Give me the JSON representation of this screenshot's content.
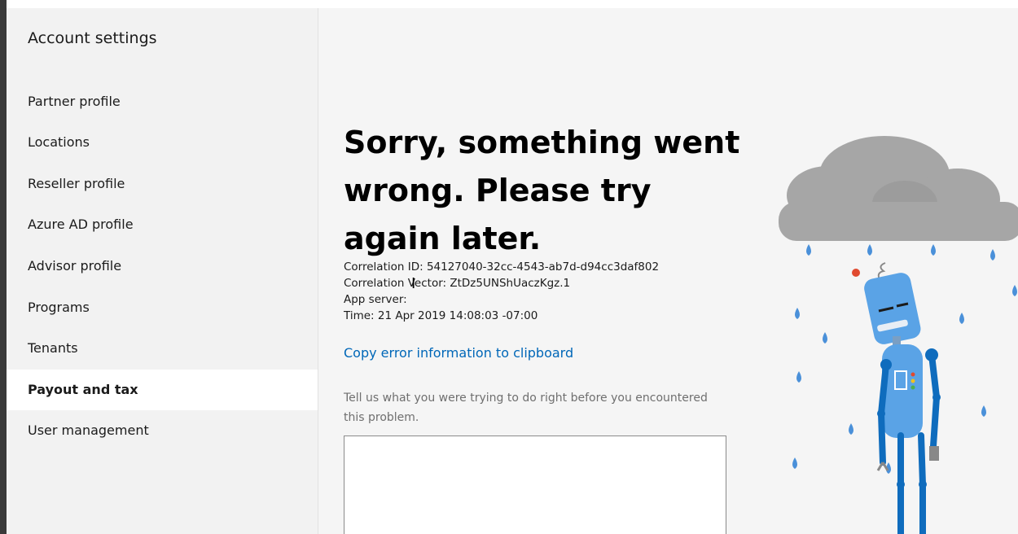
{
  "sidebar": {
    "title": "Account settings",
    "items": [
      {
        "label": "Partner profile",
        "selected": false
      },
      {
        "label": "Locations",
        "selected": false
      },
      {
        "label": "Reseller profile",
        "selected": false
      },
      {
        "label": "Azure AD profile",
        "selected": false
      },
      {
        "label": "Advisor profile",
        "selected": false
      },
      {
        "label": "Programs",
        "selected": false
      },
      {
        "label": "Tenants",
        "selected": false
      },
      {
        "label": "Payout and tax",
        "selected": true
      },
      {
        "label": "User management",
        "selected": false
      }
    ]
  },
  "error": {
    "heading": "Sorry, something went wrong. Please try again later.",
    "correlation_id": "Correlation ID: 54127040-32cc-4543-ab7d-d94cc3daf802",
    "correlation_vector": "Correlation Vector: ZtDz5UNShUaczKgz.1",
    "app_server": "App server:",
    "time": "Time: 21 Apr 2019 14:08:03 -07:00",
    "copy_link": "Copy error information to clipboard",
    "feedback_prompt": "Tell us what you were trying to do right before you encountered this problem.",
    "feedback_value": ""
  },
  "colors": {
    "link": "#0067b8",
    "cloud": "#a6a6a6",
    "raindrop": "#4a90d9",
    "robot_body": "#5aa3e6",
    "robot_joint": "#0f6cbd"
  },
  "icons": {
    "illustration": "sad-robot-under-rain-cloud",
    "cursor": "text-cursor-ibeam"
  }
}
